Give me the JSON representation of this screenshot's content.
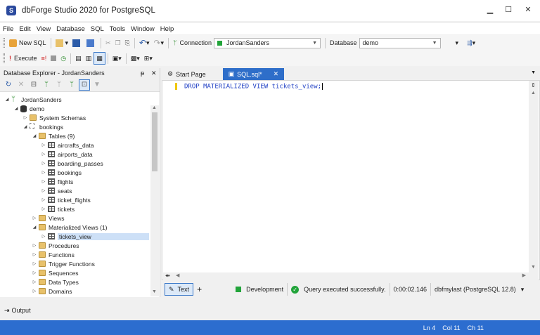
{
  "window": {
    "title": "dbForge Studio 2020 for PostgreSQL",
    "logo_letter": "S"
  },
  "menu": [
    "File",
    "Edit",
    "View",
    "Database",
    "SQL",
    "Tools",
    "Window",
    "Help"
  ],
  "toolbar1": {
    "new_sql": "New SQL",
    "connection_label": "Connection",
    "connection_value": "JordanSanders",
    "database_label": "Database",
    "database_value": "demo"
  },
  "toolbar2": {
    "execute": "Execute"
  },
  "explorer": {
    "title": "Database Explorer - JordanSanders",
    "pin": "ᵽ",
    "close": "✕",
    "tree": [
      {
        "label": "JordanSanders",
        "level": 0,
        "icon": "connection-icon",
        "expanded": true
      },
      {
        "label": "demo",
        "level": 1,
        "icon": "database-icon",
        "expanded": true
      },
      {
        "label": "System Schemas",
        "level": 2,
        "icon": "folder-icon",
        "expanded": false
      },
      {
        "label": "bookings",
        "level": 2,
        "icon": "schema-icon",
        "expanded": true
      },
      {
        "label": "Tables (9)",
        "level": 3,
        "icon": "folder-icon",
        "expanded": true
      },
      {
        "label": "aircrafts_data",
        "level": 4,
        "icon": "table-icon",
        "expanded": false
      },
      {
        "label": "airports_data",
        "level": 4,
        "icon": "table-icon",
        "expanded": false
      },
      {
        "label": "boarding_passes",
        "level": 4,
        "icon": "table-icon",
        "expanded": false
      },
      {
        "label": "bookings",
        "level": 4,
        "icon": "table-icon",
        "expanded": false
      },
      {
        "label": "flights",
        "level": 4,
        "icon": "table-icon",
        "expanded": false
      },
      {
        "label": "seats",
        "level": 4,
        "icon": "table-icon",
        "expanded": false
      },
      {
        "label": "ticket_flights",
        "level": 4,
        "icon": "table-icon",
        "expanded": false
      },
      {
        "label": "tickets",
        "level": 4,
        "icon": "table-icon",
        "expanded": false
      },
      {
        "label": "Views",
        "level": 3,
        "icon": "folder-icon",
        "expanded": false
      },
      {
        "label": "Materialized Views (1)",
        "level": 3,
        "icon": "folder-icon",
        "expanded": true
      },
      {
        "label": "tickets_view",
        "level": 4,
        "icon": "table-icon",
        "expanded": false,
        "selected": true
      },
      {
        "label": "Procedures",
        "level": 3,
        "icon": "folder-icon",
        "expanded": false
      },
      {
        "label": "Functions",
        "level": 3,
        "icon": "folder-icon",
        "expanded": false
      },
      {
        "label": "Trigger Functions",
        "level": 3,
        "icon": "folder-icon",
        "expanded": false
      },
      {
        "label": "Sequences",
        "level": 3,
        "icon": "folder-icon",
        "expanded": false
      },
      {
        "label": "Data Types",
        "level": 3,
        "icon": "folder-icon",
        "expanded": false
      },
      {
        "label": "Domains",
        "level": 3,
        "icon": "folder-icon",
        "expanded": false
      }
    ]
  },
  "tabs": [
    {
      "label": "Start Page",
      "active": false
    },
    {
      "label": "SQL.sql*",
      "active": true
    }
  ],
  "editor": {
    "code": "DROP MATERIALIZED VIEW tickets_view;"
  },
  "editor_status": {
    "text_tab": "Text",
    "add": "+",
    "environment": "Development",
    "message": "Query executed successfully.",
    "elapsed": "0:00:02.146",
    "connection": "dbfmylast (PostgreSQL 12.8)"
  },
  "output": {
    "label": "Output"
  },
  "statusbar": {
    "ln": "Ln 4",
    "col": "Col 11",
    "ch": "Ch 11"
  },
  "colors": {
    "accent": "#2c6dcf",
    "ok": "#22a43a",
    "keyword": "#1f3fc4"
  }
}
